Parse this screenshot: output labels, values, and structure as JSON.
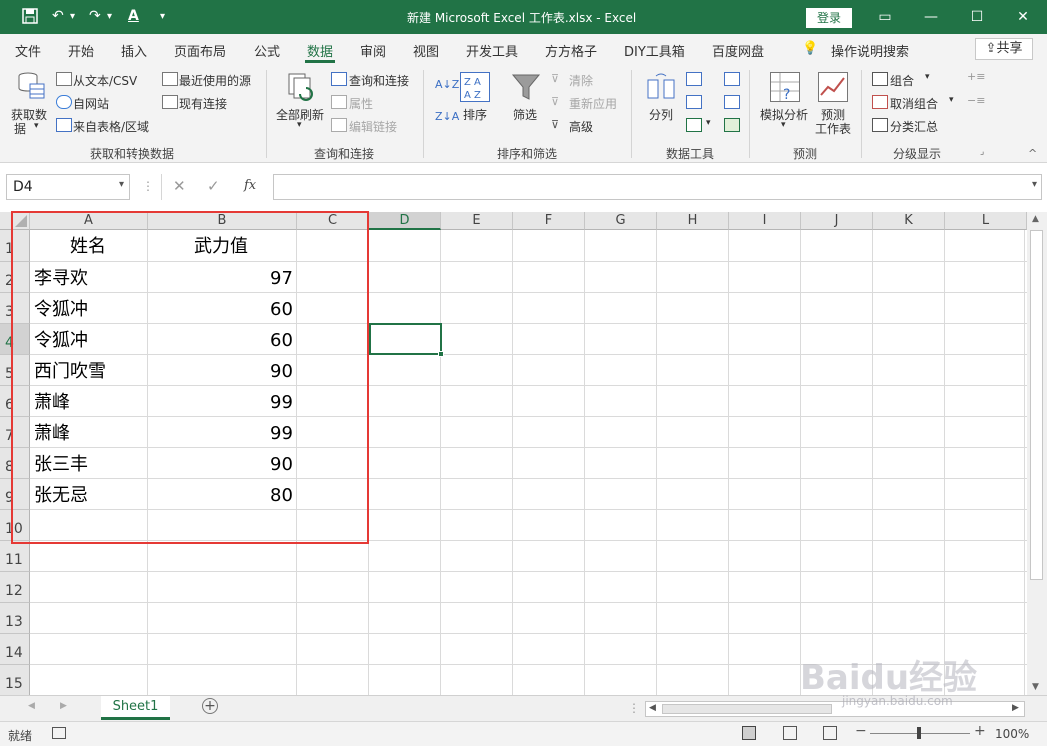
{
  "titlebar": {
    "title": "新建 Microsoft Excel 工作表.xlsx  -  Excel",
    "login": "登录",
    "quick_access": {
      "save": "save-icon",
      "undo": "undo-icon",
      "redo": "redo-icon",
      "font_color": "A"
    },
    "controls": {
      "ribbon_display": "▭",
      "minimize": "—",
      "maximize": "☐",
      "close": "✕"
    }
  },
  "tabs": [
    "文件",
    "开始",
    "插入",
    "页面布局",
    "公式",
    "数据",
    "审阅",
    "视图",
    "开发工具",
    "方方格子",
    "DIY工具箱",
    "百度网盘"
  ],
  "active_tab": "数据",
  "tell_me": "操作说明搜索",
  "share": "共享",
  "ribbon": {
    "get_transform": {
      "get_data_1": "获取数",
      "get_data_2": "据",
      "from_text": "从文本/CSV",
      "from_web": "自网站",
      "from_table": "来自表格/区域",
      "recent_sources": "最近使用的源",
      "existing_conn": "现有连接",
      "label": "获取和转换数据"
    },
    "queries": {
      "refresh_all": "全部刷新",
      "queries_conn": "查询和连接",
      "properties": "属性",
      "edit_links": "编辑链接",
      "label": "查询和连接"
    },
    "sort_filter": {
      "sort": "排序",
      "filter": "筛选",
      "clear": "清除",
      "reapply": "重新应用",
      "advanced": "高级",
      "label": "排序和筛选"
    },
    "data_tools": {
      "split": "分列",
      "label": "数据工具"
    },
    "forecast": {
      "what_if": "模拟分析",
      "forecast_1": "预测",
      "forecast_2": "工作表",
      "label": "预测"
    },
    "outline": {
      "group": "组合",
      "ungroup": "取消组合",
      "subtotal": "分类汇总",
      "label": "分级显示"
    }
  },
  "formula_bar": {
    "name_box": "D4",
    "cancel": "✕",
    "enter": "✓",
    "fx": "fx",
    "value": ""
  },
  "columns": [
    "A",
    "B",
    "C",
    "D",
    "E",
    "F",
    "G",
    "H",
    "I",
    "J",
    "K",
    "L"
  ],
  "rows": [
    "1",
    "2",
    "3",
    "4",
    "5",
    "6",
    "7",
    "8",
    "9",
    "10",
    "11",
    "12",
    "13",
    "14",
    "15"
  ],
  "selected_cell": "D4",
  "table": {
    "header": {
      "name": "姓名",
      "power": "武力值"
    },
    "rows": [
      {
        "name": "李寻欢",
        "power": "97"
      },
      {
        "name": "令狐冲",
        "power": "60"
      },
      {
        "name": "令狐冲",
        "power": "60"
      },
      {
        "name": "西门吹雪",
        "power": "90"
      },
      {
        "name": "萧峰",
        "power": "99"
      },
      {
        "name": "萧峰",
        "power": "99"
      },
      {
        "name": "张三丰",
        "power": "90"
      },
      {
        "name": "张无忌",
        "power": "80"
      }
    ]
  },
  "sheet_tab": "Sheet1",
  "status": {
    "ready": "就绪",
    "zoom": "100%"
  },
  "watermark": {
    "text": "Baidu经验",
    "url": "jingyan.baidu.com"
  },
  "colors": {
    "excel_green": "#217346",
    "highlight_red": "#e53935"
  }
}
